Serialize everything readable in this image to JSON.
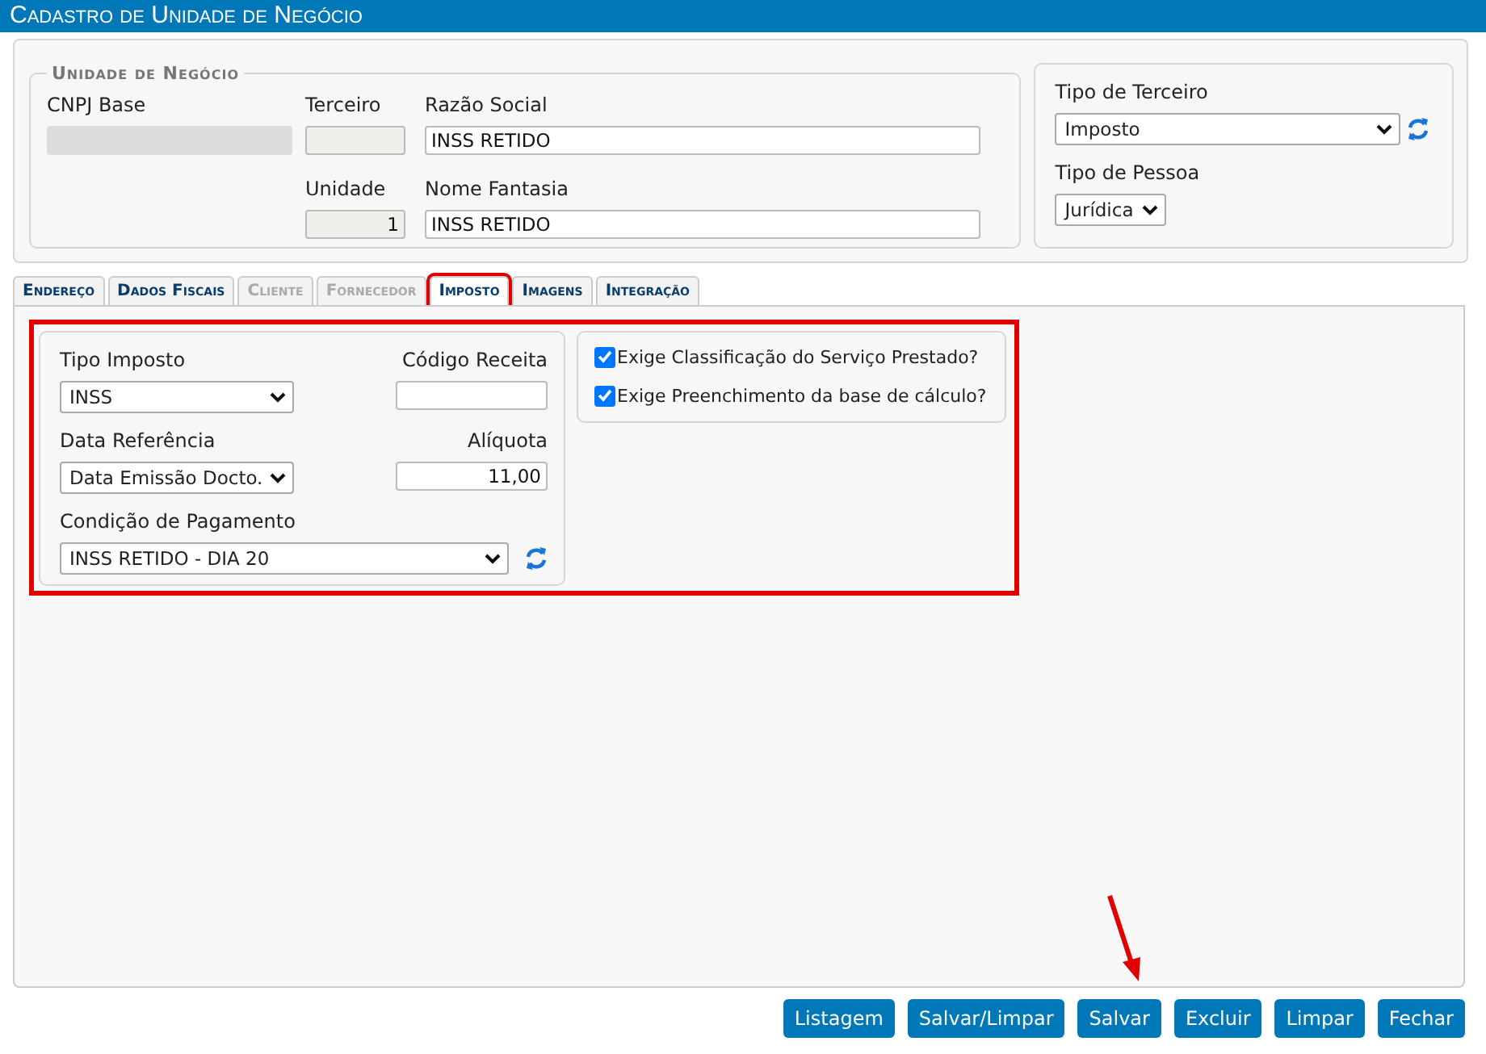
{
  "window": {
    "title": "Cadastro de Unidade de Negócio"
  },
  "unidade": {
    "legend": "Unidade de Negócio",
    "cnpj_label": "CNPJ Base",
    "terceiro_label": "Terceiro",
    "razao_label": "Razão Social",
    "razao_value": "INSS RETIDO",
    "unidade_label": "Unidade",
    "unidade_value": "1",
    "fantasia_label": "Nome Fantasia",
    "fantasia_value": "INSS RETIDO"
  },
  "terceiro": {
    "tipo_terceiro_label": "Tipo de Terceiro",
    "tipo_terceiro_value": "Imposto",
    "tipo_pessoa_label": "Tipo de Pessoa",
    "tipo_pessoa_value": "Jurídica"
  },
  "tabs": [
    {
      "label": "Endereço",
      "selected": false,
      "disabled": false
    },
    {
      "label": "Dados Fiscais",
      "selected": false,
      "disabled": false
    },
    {
      "label": "Cliente",
      "selected": false,
      "disabled": true
    },
    {
      "label": "Fornecedor",
      "selected": false,
      "disabled": true
    },
    {
      "label": "Imposto",
      "selected": true,
      "disabled": false
    },
    {
      "label": "Imagens",
      "selected": false,
      "disabled": false
    },
    {
      "label": "Integração",
      "selected": false,
      "disabled": false
    }
  ],
  "imposto": {
    "tipo_label": "Tipo Imposto",
    "tipo_value": "INSS",
    "codigo_label": "Código Receita",
    "data_label": "Data Referência",
    "data_value": "Data Emissão Docto.",
    "aliquota_label": "Alíquota",
    "aliquota_value": "11,00",
    "condicao_label": "Condição de Pagamento",
    "condicao_value": "INSS RETIDO - DIA 20"
  },
  "checks": [
    {
      "label": "Exige Classificação do Serviço Prestado?",
      "checked": true
    },
    {
      "label": "Exige Preenchimento da base de cálculo?",
      "checked": true
    }
  ],
  "buttons": [
    "Listagem",
    "Salvar/Limpar",
    "Salvar",
    "Excluir",
    "Limpar",
    "Fechar"
  ]
}
